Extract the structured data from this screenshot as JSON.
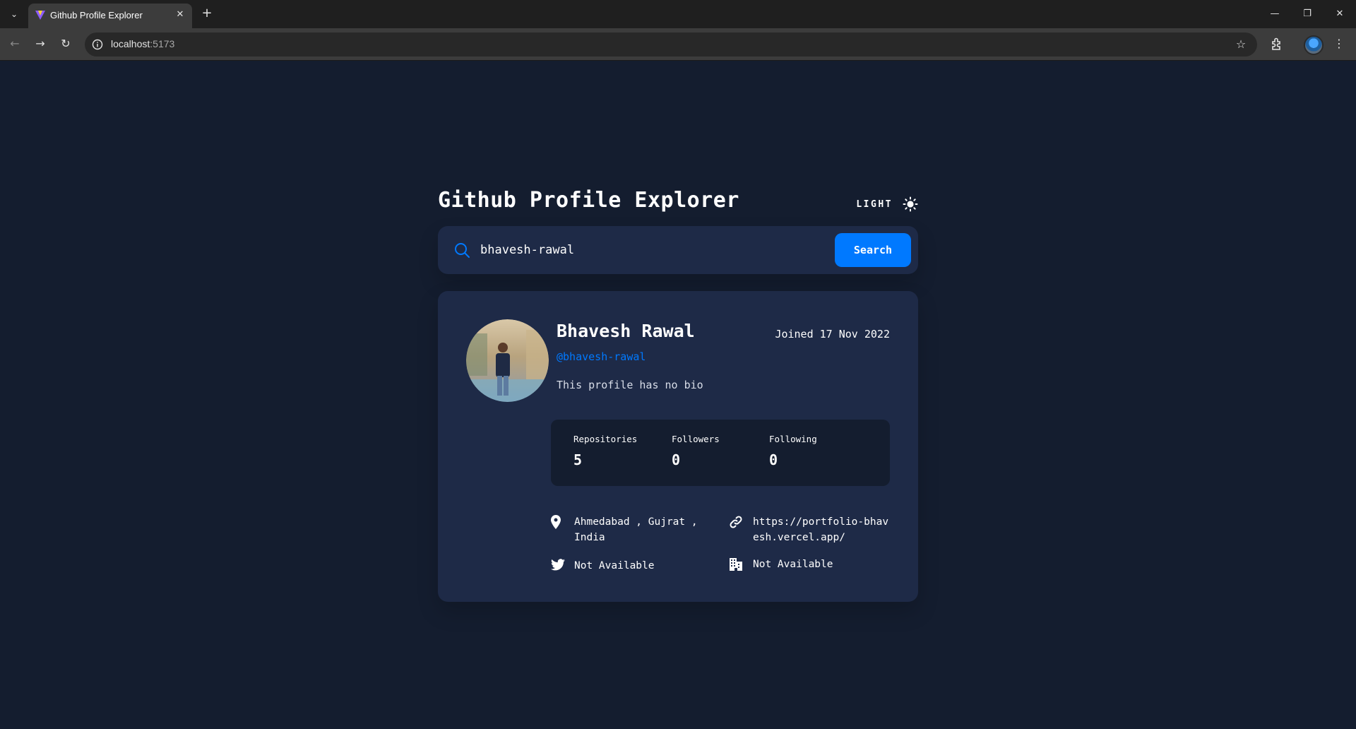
{
  "browser": {
    "tab_title": "Github Profile Explorer",
    "url_host": "localhost",
    "url_port": ":5173"
  },
  "app": {
    "title": "Github Profile Explorer",
    "theme_toggle_label": "LIGHT",
    "search": {
      "value": "bhavesh-rawal",
      "button_label": "Search"
    },
    "profile": {
      "name": "Bhavesh Rawal",
      "joined": "Joined 17 Nov 2022",
      "login": "@bhavesh-rawal",
      "bio": "This profile has no bio",
      "stats": [
        {
          "label": "Repositories",
          "value": "5"
        },
        {
          "label": "Followers",
          "value": "0"
        },
        {
          "label": "Following",
          "value": "0"
        }
      ],
      "location": "Ahmedabad , Gujrat , India",
      "blog": "https://portfolio-bhavesh.vercel.app/",
      "twitter": "Not Available",
      "company": "Not Available"
    }
  },
  "colors": {
    "background": "#141d2f",
    "card": "#1e2a47",
    "accent": "#0079ff"
  },
  "icons": [
    "chevron-down-icon",
    "vite-favicon-icon",
    "close-icon",
    "plus-icon",
    "minimize-icon",
    "restore-icon",
    "back-icon",
    "forward-icon",
    "reload-icon",
    "info-icon",
    "star-icon",
    "extensions-icon",
    "kebab-menu-icon",
    "sun-icon",
    "search-icon",
    "location-pin-icon",
    "link-icon",
    "twitter-icon",
    "building-icon"
  ]
}
